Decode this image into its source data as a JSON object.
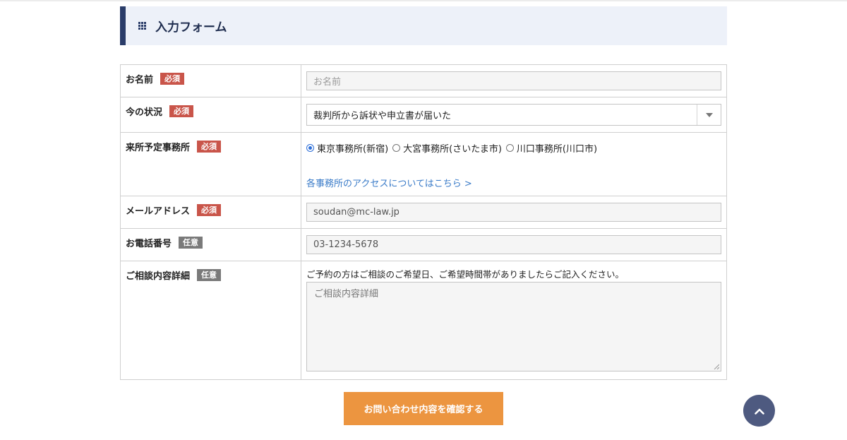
{
  "section": {
    "title": "入力フォーム"
  },
  "badges": {
    "required": "必須",
    "optional": "任意"
  },
  "fields": {
    "name": {
      "label": "お名前",
      "placeholder": "お名前"
    },
    "status": {
      "label": "今の状況",
      "selected": "裁判所から訴状や申立書が届いた"
    },
    "office": {
      "label": "来所予定事務所",
      "options": [
        "東京事務所(新宿)",
        "大宮事務所(さいたま市)",
        "川口事務所(川口市)"
      ],
      "selected_index": 0,
      "access_link": "各事務所のアクセスについてはこちら >"
    },
    "email": {
      "label": "メールアドレス",
      "placeholder": "soudan@mc-law.jp"
    },
    "phone": {
      "label": "お電話番号",
      "placeholder": "03-1234-5678"
    },
    "details": {
      "label": "ご相談内容詳細",
      "note": "ご予約の方はご相談のご希望日、ご希望時間帯がありましたらご記入ください。",
      "placeholder": "ご相談内容詳細"
    }
  },
  "submit": {
    "label": "お問い合わせ内容を確認する"
  },
  "colors": {
    "header_bg": "#edf1f9",
    "header_accent": "#2a3c69",
    "required_badge": "#c9554a",
    "optional_badge": "#7a7a7a",
    "submit_bg": "#ec9540",
    "link": "#3a7bc8",
    "scroll_top_bg": "#4e5a80"
  },
  "icons": {
    "header": "grid-dots-icon",
    "select": "chevron-down-icon",
    "scroll_top": "chevron-up-icon"
  }
}
